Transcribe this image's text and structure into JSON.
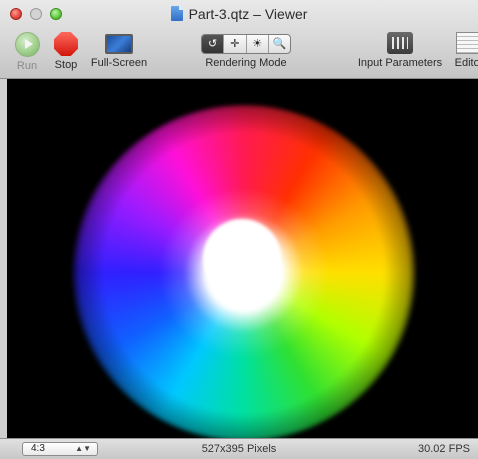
{
  "window": {
    "title": "Part-3.qtz – Viewer",
    "doc_icon": "qtz-document-icon"
  },
  "toolbar": {
    "run_label": "Run",
    "stop_label": "Stop",
    "fullscreen_label": "Full-Screen",
    "rendering_mode_label": "Rendering Mode",
    "rendering_modes": [
      "↺",
      "✛",
      "☀",
      "🔍"
    ],
    "input_parameters_label": "Input Parameters",
    "editor_label": "Editor"
  },
  "statusbar": {
    "aspect_ratio": "4:3",
    "dimensions": "527x395 Pixels",
    "fps": "30.02 FPS"
  },
  "colors": {
    "close_button": "#e0443a",
    "zoom_button": "#5ec93b",
    "stop_icon": "#d2150b",
    "viewer_background": "#000000"
  }
}
